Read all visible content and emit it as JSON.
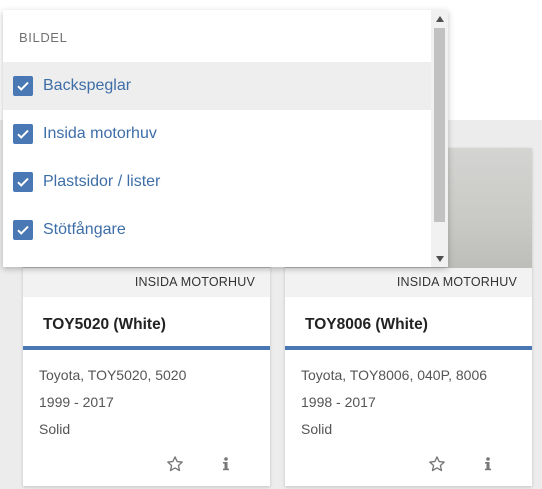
{
  "filter": {
    "header": "BILDEL",
    "items": [
      {
        "label": "Backspeglar",
        "checked": true,
        "highlighted": true
      },
      {
        "label": "Insida motorhuv",
        "checked": true,
        "highlighted": false
      },
      {
        "label": "Plastsidor / lister",
        "checked": true,
        "highlighted": false
      },
      {
        "label": "Stötfångare",
        "checked": true,
        "highlighted": false
      }
    ]
  },
  "cards": [
    {
      "tag": "INSIDA MOTORHUV",
      "title": "TOY5020 (White)",
      "line1": "Toyota, TOY5020, 5020",
      "line2": "1999 - 2017",
      "line3": "Solid"
    },
    {
      "tag": "INSIDA MOTORHUV",
      "title": "TOY8006 (White)",
      "line1": "Toyota, TOY8006, 040P, 8006",
      "line2": "1998 - 2017",
      "line3": "Solid"
    }
  ],
  "icons": {
    "checkbox": "check-icon",
    "favorite": "star-icon",
    "info": "info-icon"
  },
  "colors": {
    "accent": "#4a78b4",
    "label": "#3d6ea8"
  }
}
